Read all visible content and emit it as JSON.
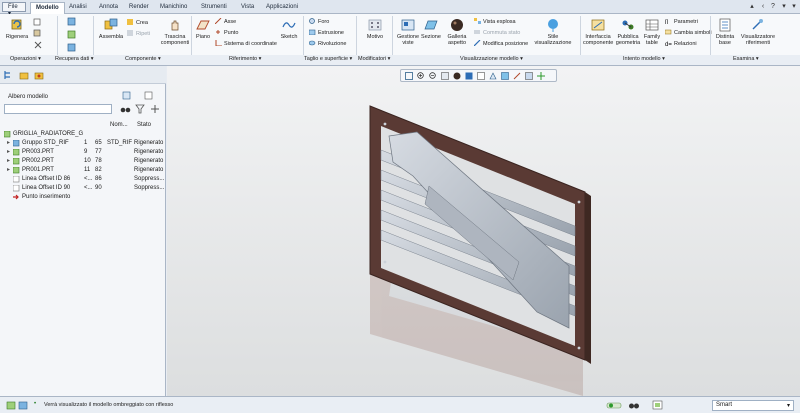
{
  "tabs": {
    "file": "File ▾",
    "items": [
      "Modello",
      "Analisi",
      "Annota",
      "Render",
      "Manichino",
      "Strumenti",
      "Vista",
      "Applicazioni"
    ],
    "active": "Modello"
  },
  "ribbon": {
    "buttons": {
      "rigenera": "Rigenera",
      "assembla": "Assembla",
      "crea": "Crea",
      "ripeti": "Ripeti",
      "trascina": "Trascina componenti",
      "piano": "Piano",
      "asse": "Asse",
      "punto": "Punto",
      "sistema": "Sistema di coordinate",
      "sketch": "Sketch",
      "foro": "Foro",
      "estrusione": "Estrusione",
      "rivoluzione": "Rivoluzione",
      "motivo": "Motivo",
      "gestione_viste": "Gestione viste",
      "sezione": "Sezione",
      "galleria": "Galleria aspetto",
      "vista_esplosa": "Vista esplosa",
      "commuta_stato": "Commuta stato",
      "modifica_posizione": "Modifica posizione",
      "stile": "Stile visualizzazione",
      "interfaccia": "Interfaccia componente",
      "pubblica": "Pubblica geometria",
      "family": "Family table",
      "parametri": "Parametri",
      "cambia_simboli": "Cambia simboli",
      "relazioni": "Relazioni",
      "distinta": "Distinta base",
      "visualizzatore": "Visualizzatore riferimenti"
    },
    "groups": [
      "Operazioni ▾",
      "Recupera dati ▾",
      "Componente ▾",
      "Riferimento ▾",
      "Taglio e superficie ▾",
      "Modificatori ▾",
      "Visualizzazione modello ▾",
      "Intento modello ▾",
      "Esamina ▾"
    ]
  },
  "model_tree": {
    "title": "Albero modello",
    "columns": [
      "Nom...",
      "Stato"
    ],
    "root": "GRIGLIA_RADIATORE_G",
    "rows": [
      {
        "name": "Gruppo STD_RIF",
        "n1": "1",
        "n2": "65",
        "nom": "STD_RIF",
        "stato": "Rigenerato"
      },
      {
        "name": "PR003.PRT",
        "n1": "9",
        "n2": "77",
        "nom": "",
        "stato": "Rigenerato"
      },
      {
        "name": "PR002.PRT",
        "n1": "10",
        "n2": "78",
        "nom": "",
        "stato": "Rigenerato"
      },
      {
        "name": "PR001.PRT",
        "n1": "11",
        "n2": "82",
        "nom": "",
        "stato": "Rigenerato"
      },
      {
        "name": "Linea Offset ID 86",
        "n1": "<...",
        "n2": "86",
        "nom": "",
        "stato": "Soppress..."
      },
      {
        "name": "Linea Offset ID 90",
        "n1": "<...",
        "n2": "90",
        "nom": "",
        "stato": "Soppress..."
      },
      {
        "name": "Punto inserimento",
        "n1": "",
        "n2": "",
        "nom": "",
        "stato": ""
      }
    ]
  },
  "status": {
    "message": "Verrà visualizzato il modello ombreggiato con riflesso",
    "filter": "Smart"
  },
  "colors": {
    "plate": "#5a3a34",
    "metal": "#c6ccd4",
    "accent": "#2d6db5"
  }
}
